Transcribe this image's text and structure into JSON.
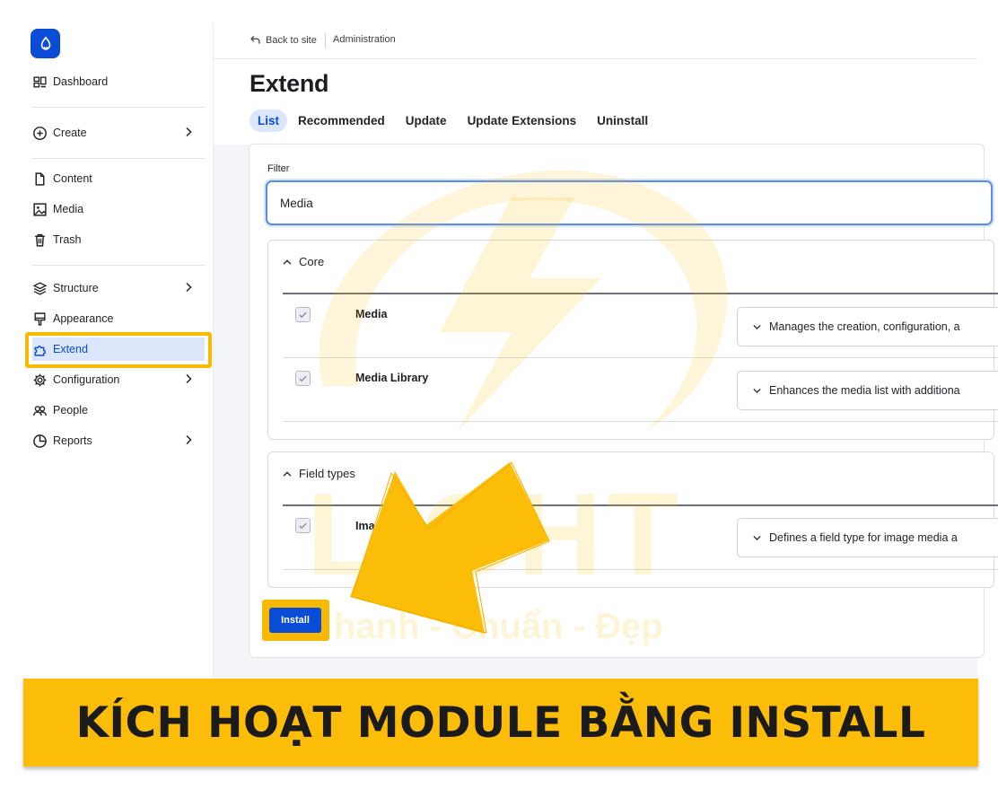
{
  "sidebar": {
    "items": [
      {
        "label": "Dashboard",
        "icon": "dashboard-icon"
      },
      {
        "label": "Create",
        "icon": "plus-circle-icon",
        "has_submenu": true
      },
      {
        "label": "Content",
        "icon": "document-icon"
      },
      {
        "label": "Media",
        "icon": "image-icon"
      },
      {
        "label": "Trash",
        "icon": "trash-icon"
      },
      {
        "label": "Structure",
        "icon": "layers-icon",
        "has_submenu": true
      },
      {
        "label": "Appearance",
        "icon": "brush-icon"
      },
      {
        "label": "Extend",
        "icon": "puzzle-icon",
        "active": true
      },
      {
        "label": "Configuration",
        "icon": "gear-icon",
        "has_submenu": true
      },
      {
        "label": "People",
        "icon": "people-icon"
      },
      {
        "label": "Reports",
        "icon": "chart-icon",
        "has_submenu": true
      }
    ]
  },
  "topbar": {
    "back_label": "Back to site",
    "breadcrumb": "Administration"
  },
  "page": {
    "title": "Extend",
    "tabs": [
      {
        "label": "List",
        "active": true
      },
      {
        "label": "Recommended"
      },
      {
        "label": "Update"
      },
      {
        "label": "Update Extensions"
      },
      {
        "label": "Uninstall"
      }
    ]
  },
  "filter": {
    "label": "Filter",
    "value": "Media"
  },
  "groups": [
    {
      "title": "Core",
      "modules": [
        {
          "name": "Media",
          "checked": true,
          "description": "Manages the creation, configuration, a"
        },
        {
          "name": "Media Library",
          "checked": true,
          "description": "Enhances the media list with additiona"
        }
      ]
    },
    {
      "title": "Field types",
      "modules": [
        {
          "name": "Ima",
          "checked": true,
          "description": "Defines a field type for image media a"
        }
      ]
    }
  ],
  "actions": {
    "install_label": "Install"
  },
  "watermark": {
    "line1": "LIGHT",
    "line2": "hanh - Chuẩn - Đẹp"
  },
  "banner": {
    "text": "KÍCH HOẠT MODULE BẰNG INSTALL"
  },
  "colors": {
    "accent": "#0a4cd6",
    "highlight": "#f8b900",
    "banner": "#fcbd09"
  }
}
